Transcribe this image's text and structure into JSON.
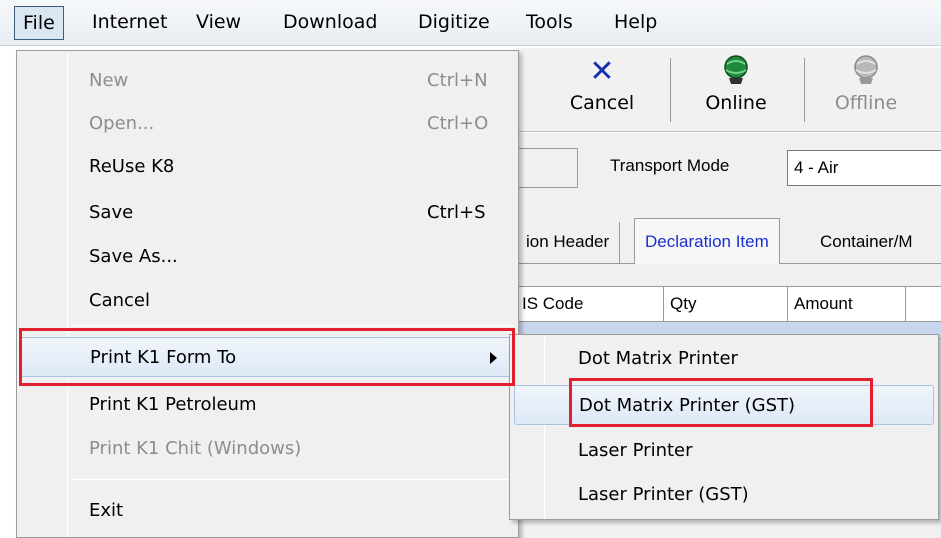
{
  "menubar": {
    "items": [
      "File",
      "Internet",
      "View",
      "Download",
      "Digitize",
      "Tools",
      "Help"
    ]
  },
  "toolbar": {
    "cancel_label": "Cancel",
    "online_label": "Online",
    "offline_label": "Offline"
  },
  "form": {
    "transport_mode_label": "Transport Mode",
    "transport_mode_value": "4 - Air"
  },
  "tabs": [
    "ion Header",
    "Declaration Item",
    "Container/M"
  ],
  "grid": {
    "columns": [
      "IS Code",
      "Qty",
      "Amount"
    ]
  },
  "file_menu": {
    "items": [
      {
        "label": "New",
        "shortcut": "Ctrl+N",
        "enabled": false
      },
      {
        "label": "Open...",
        "shortcut": "Ctrl+O",
        "enabled": false
      },
      {
        "label": "ReUse K8",
        "shortcut": "",
        "enabled": true
      },
      {
        "label": "Save",
        "shortcut": "Ctrl+S",
        "enabled": true
      },
      {
        "label": "Save As...",
        "shortcut": "",
        "enabled": true
      },
      {
        "label": "Cancel",
        "shortcut": "",
        "enabled": true
      },
      {
        "label": "Print K1 Form To",
        "shortcut": "",
        "enabled": true,
        "highlighted": true,
        "has_submenu": true
      },
      {
        "label": "Print K1 Petroleum",
        "shortcut": "",
        "enabled": true
      },
      {
        "label": "Print K1 Chit (Windows)",
        "shortcut": "",
        "enabled": false
      },
      {
        "label": "Exit",
        "shortcut": "",
        "enabled": true
      }
    ]
  },
  "print_submenu": {
    "items": [
      {
        "label": "Dot Matrix Printer"
      },
      {
        "label": "Dot Matrix Printer (GST)",
        "highlighted": true
      },
      {
        "label": "Laser Printer"
      },
      {
        "label": "Laser Printer (GST)"
      }
    ]
  },
  "colors": {
    "annotation": "#e0202e",
    "active_tab_text": "#1a2fd0",
    "highlight_border": "#a9c2e4"
  }
}
